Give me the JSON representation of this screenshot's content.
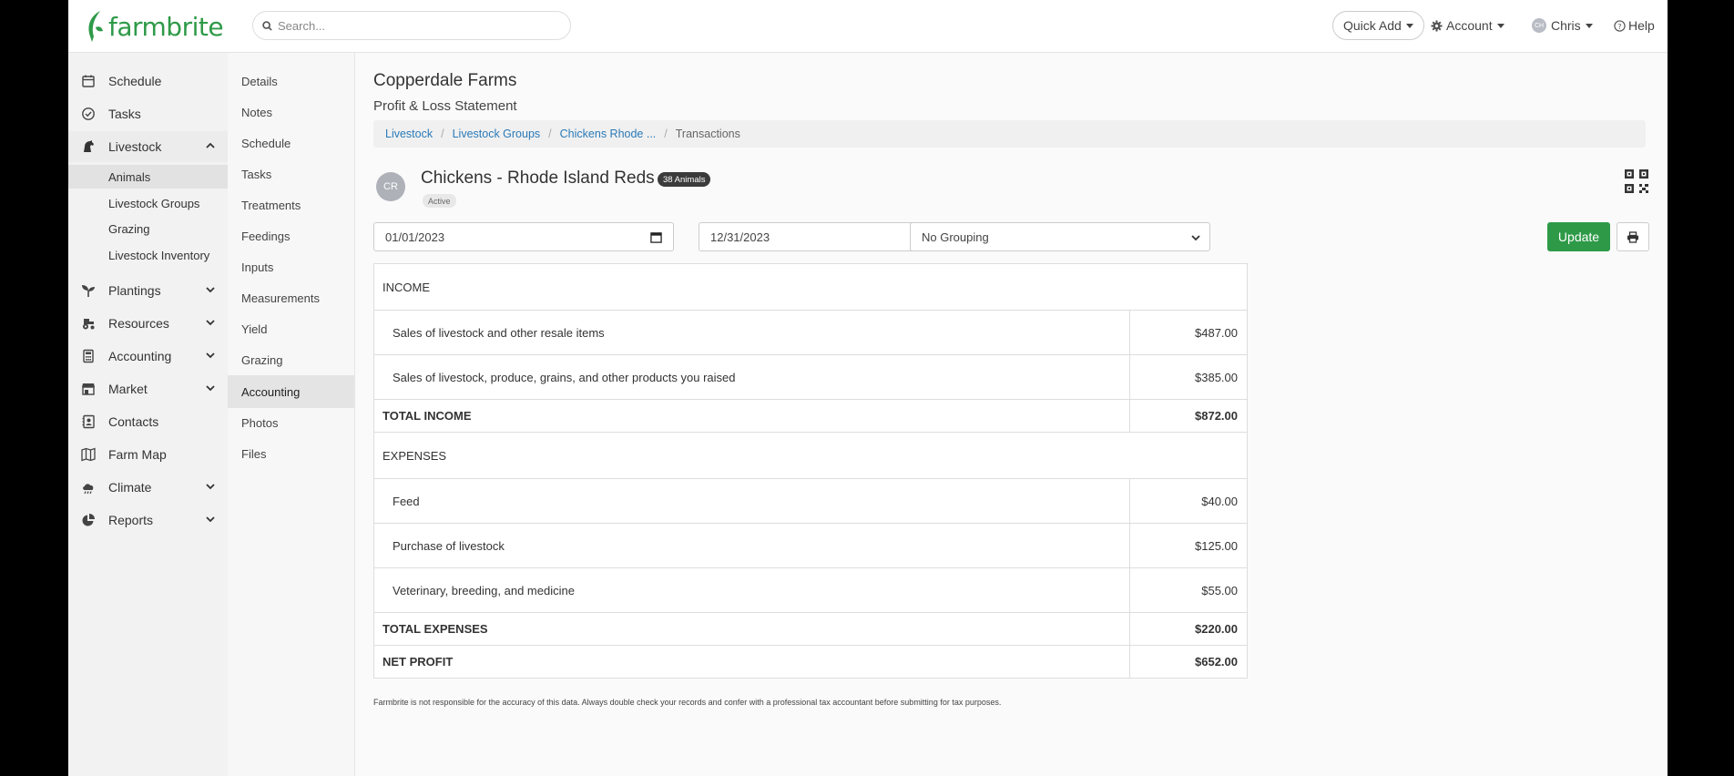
{
  "brand": {
    "name": "farmbrite",
    "color": "#2e9a48"
  },
  "search": {
    "placeholder": "Search..."
  },
  "topnav": {
    "quick_add": "Quick Add",
    "account": "Account",
    "user_initials": "CH",
    "user": "Chris",
    "help": "Help"
  },
  "sidebar": {
    "items": [
      {
        "label": "Schedule",
        "icon": "calendar-icon"
      },
      {
        "label": "Tasks",
        "icon": "check-circle-icon"
      },
      {
        "label": "Livestock",
        "icon": "horse-icon"
      },
      {
        "label": "Plantings",
        "icon": "seedling-icon"
      },
      {
        "label": "Resources",
        "icon": "tractor-icon"
      },
      {
        "label": "Accounting",
        "icon": "calculator-icon"
      },
      {
        "label": "Market",
        "icon": "store-icon"
      },
      {
        "label": "Contacts",
        "icon": "address-book-icon"
      },
      {
        "label": "Farm Map",
        "icon": "map-icon"
      },
      {
        "label": "Climate",
        "icon": "cloud-icon"
      },
      {
        "label": "Reports",
        "icon": "pie-chart-icon"
      }
    ],
    "livestock_sub": [
      "Animals",
      "Livestock Groups",
      "Grazing",
      "Livestock Inventory"
    ]
  },
  "subnav": [
    "Details",
    "Notes",
    "Schedule",
    "Tasks",
    "Treatments",
    "Feedings",
    "Inputs",
    "Measurements",
    "Yield",
    "Grazing",
    "Accounting",
    "Photos",
    "Files"
  ],
  "page": {
    "farm_name": "Copperdale Farms",
    "subtitle": "Profit & Loss Statement",
    "breadcrumb": [
      "Livestock",
      "Livestock Groups",
      "Chickens Rhode ...",
      "Transactions"
    ]
  },
  "entity": {
    "initials": "CR",
    "title": "Chickens - Rhode Island Reds",
    "count_badge": "38 Animals",
    "status": "Active"
  },
  "filters": {
    "start_date": "01/01/2023",
    "end_date": "12/31/2023",
    "grouping": "No Grouping",
    "update_label": "Update"
  },
  "statement": {
    "income_header": "INCOME",
    "income": [
      {
        "label": "Sales of livestock and other resale items",
        "amount": "$487.00"
      },
      {
        "label": "Sales of livestock, produce, grains, and other products you raised",
        "amount": "$385.00"
      }
    ],
    "total_income_label": "TOTAL INCOME",
    "total_income": "$872.00",
    "expenses_header": "EXPENSES",
    "expenses": [
      {
        "label": "Feed",
        "amount": "$40.00"
      },
      {
        "label": "Purchase of livestock",
        "amount": "$125.00"
      },
      {
        "label": "Veterinary, breeding, and medicine",
        "amount": "$55.00"
      }
    ],
    "total_expenses_label": "TOTAL EXPENSES",
    "total_expenses": "$220.00",
    "net_profit_label": "NET PROFIT",
    "net_profit": "$652.00"
  },
  "disclaimer": "Farmbrite is not responsible for the accuracy of this data. Always double check your records and confer with a professional tax accountant before submitting for tax purposes."
}
